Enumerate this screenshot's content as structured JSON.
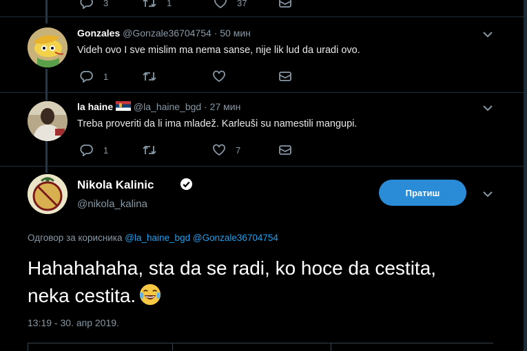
{
  "top_actions": {
    "reply_count": "3",
    "retweet_count": "1",
    "like_count": "37"
  },
  "replies": [
    {
      "name": "Gonzales",
      "handle": "@Gonzale36704754",
      "time": "· 50 мин",
      "text": "Videh ovo I sve mislim ma nema sanse, nije lik lud da uradi ovo.",
      "reply_count": "1",
      "retweet_count": "",
      "like_count": ""
    },
    {
      "name": "la haine",
      "handle": "@la_haine_bgd",
      "time": "· 27 мин",
      "text": "Treba proveriti da li ima mladež. Karleuši su namestili mangupi.",
      "reply_count": "1",
      "retweet_count": "",
      "like_count": "7"
    }
  ],
  "main_tweet": {
    "name": "Nikola Kalinic",
    "handle": "@nikola_kalina",
    "follow_label": "Пратиш",
    "replying_prefix": "Одговор за корисника",
    "mention_1": "@la_haine_bgd",
    "mention_2": "@Gonzale36704754",
    "text": "Hahahahaha, sta da se radi, ko hoce da cestita, neka cestita.",
    "timestamp": "13:19 - 30. апр 2019."
  },
  "colors": {
    "background": "#000000",
    "accent": "#2a8bd6",
    "muted": "#8899a6",
    "link": "#1da1f2"
  },
  "icons": [
    "reply-icon",
    "retweet-icon",
    "like-icon",
    "dm-icon",
    "chevron-down-icon",
    "verified-icon",
    "laughing-emoji"
  ]
}
